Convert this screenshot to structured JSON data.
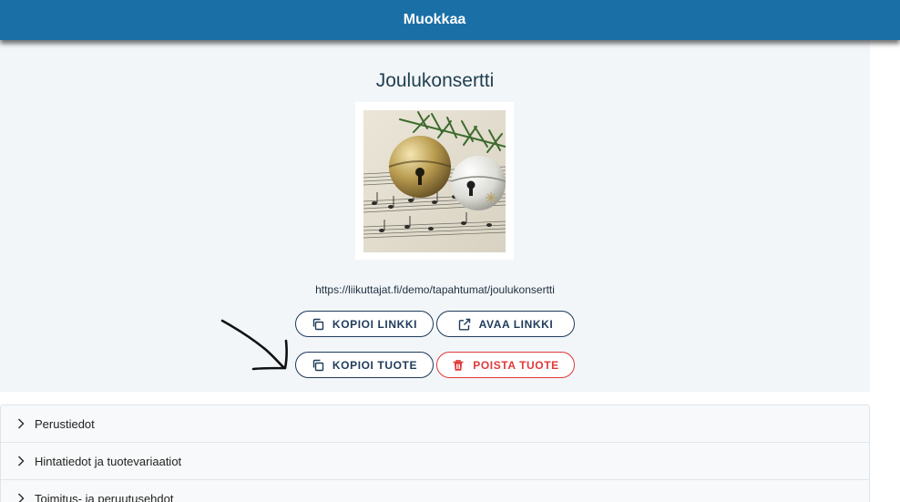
{
  "header": {
    "title": "Muokkaa"
  },
  "product": {
    "title": "Joulukonsertti",
    "link": "https://liikuttajat.fi/demo/tapahtumat/joulukonsertti"
  },
  "buttons": {
    "copy_link": "KOPIOI LINKKI",
    "open_link": "AVAA LINKKI",
    "copy_product": "KOPIOI TUOTE",
    "delete_product": "POISTA TUOTE"
  },
  "accordion": {
    "items": [
      {
        "label": "Perustiedot"
      },
      {
        "label": "Hintatiedot ja tuotevariaatiot"
      },
      {
        "label": "Toimitus- ja peruutusehdot"
      }
    ]
  },
  "colors": {
    "header_bg": "#1a6fa7",
    "primary_outline": "#1f3b5a",
    "danger": "#e0393a",
    "panel_bg": "#f3f6f9"
  },
  "icons": [
    "copy-icon",
    "external-link-icon",
    "copy-icon",
    "trash-icon",
    "chevron-right-icon",
    "hand-drawn-arrow"
  ]
}
